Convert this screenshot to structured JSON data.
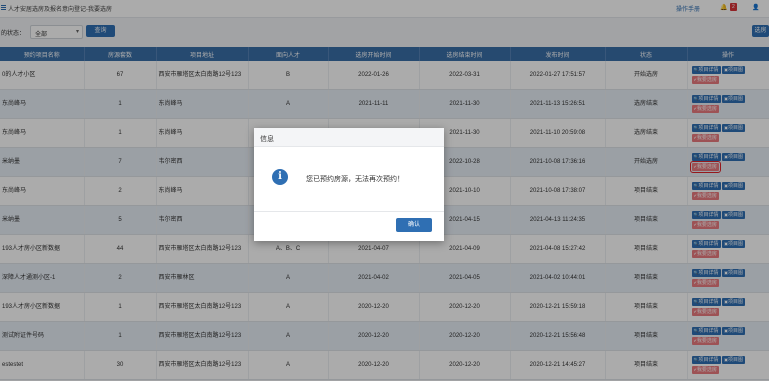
{
  "header": {
    "breadcrumb": "人才安居选房及报名意向登记-我要选房",
    "manual_link": "操作手册",
    "notification_count": "2"
  },
  "filter": {
    "label": "的状态：",
    "selected": "全部",
    "query_button": "查询",
    "register_button": "选房"
  },
  "table": {
    "columns": [
      "预约项目名称",
      "房源套数",
      "项目地址",
      "面向人才",
      "选房开始时间",
      "选房结束时间",
      "发布时间",
      "状态",
      "操作"
    ],
    "rows": [
      {
        "name": "0的人才小区",
        "count": "67",
        "address": "西安市雁塔区太白南路12号123",
        "talent": "B",
        "start": "2022-01-26",
        "end": "2022-03-31",
        "published": "2022-01-27 17:51:57",
        "status": "开始选房"
      },
      {
        "name": "东尚峰马",
        "count": "1",
        "address": "东尚峰马",
        "talent": "A",
        "start": "2021-11-11",
        "end": "2021-11-30",
        "published": "2021-11-13 15:26:51",
        "status": "选房结束"
      },
      {
        "name": "东尚峰马",
        "count": "1",
        "address": "东尚峰马",
        "talent": "A",
        "start": "",
        "end": "2021-11-30",
        "published": "2021-11-10 20:59:08",
        "status": "选房结束"
      },
      {
        "name": "米纳墨",
        "count": "7",
        "address": "韦尔密西",
        "talent": "",
        "start": "",
        "end": "2022-10-28",
        "published": "2021-10-08 17:36:16",
        "status": "开始选房"
      },
      {
        "name": "东尚峰马",
        "count": "2",
        "address": "东尚峰马",
        "talent": "",
        "start": "",
        "end": "2021-10-10",
        "published": "2021-10-08 17:38:07",
        "status": "项目结束"
      },
      {
        "name": "米纳墨",
        "count": "5",
        "address": "韦尔密西",
        "talent": "",
        "start": "",
        "end": "2021-04-15",
        "published": "2021-04-13 11:24:35",
        "status": "项目结束"
      },
      {
        "name": "193人才房小区新数据",
        "count": "44",
        "address": "西安市雁塔区太白南路12号123",
        "talent": "A、B、C",
        "start": "2021-04-07",
        "end": "2021-04-09",
        "published": "2021-04-08 15:27:42",
        "status": "项目结束"
      },
      {
        "name": "深障人才通测小区-1",
        "count": "2",
        "address": "西安市雁林区",
        "talent": "A",
        "start": "2021-04-02",
        "end": "2021-04-05",
        "published": "2021-04-02 10:44:01",
        "status": "项目结束"
      },
      {
        "name": "193人才房小区新数据",
        "count": "1",
        "address": "西安市雁塔区太白南路12号123",
        "talent": "A",
        "start": "2020-12-20",
        "end": "2020-12-20",
        "published": "2020-12-21 15:59:18",
        "status": "项目结束"
      },
      {
        "name": "测试附证件号码",
        "count": "1",
        "address": "西安市雁塔区太白南路12号123",
        "talent": "A",
        "start": "2020-12-20",
        "end": "2020-12-20",
        "published": "2020-12-21 15:56:48",
        "status": "项目结束"
      },
      {
        "name": "estestet",
        "count": "30",
        "address": "西安市雁塔区太白南路12号123",
        "talent": "A",
        "start": "2020-12-20",
        "end": "2020-12-20",
        "published": "2020-12-21 14:45:27",
        "status": "项目结束"
      }
    ],
    "ops": {
      "detail": "项目详情",
      "pics": "项目图",
      "select": "我要选房"
    }
  },
  "dialog": {
    "title": "信息",
    "message": "您已预约房源，无法再次预约！",
    "ok": "确认"
  },
  "colors": {
    "primary": "#2f6fb3",
    "header_bg": "#3a6fa8",
    "select_btn": "#ea7b7f",
    "badge": "#d9343a"
  },
  "icons": {
    "menu": "menu-icon",
    "bell": "bell-icon",
    "user": "user-icon",
    "info": "info-icon",
    "search": "search-icon",
    "image": "image-icon",
    "check": "check-icon"
  }
}
